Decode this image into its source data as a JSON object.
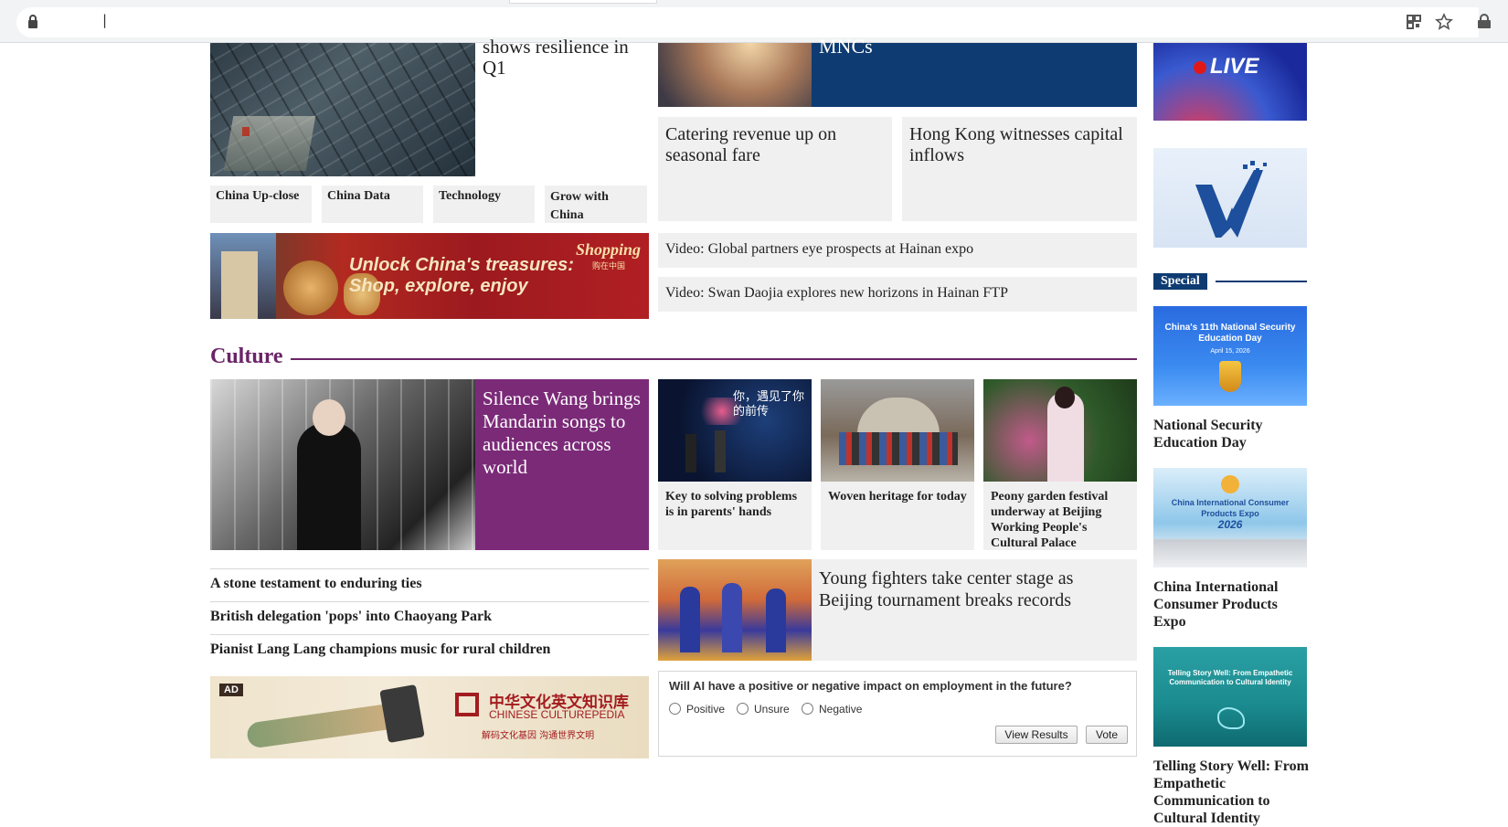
{
  "top": {
    "feature_left_title": "shows resilience in Q1",
    "feature_right_title": "MNCs",
    "tiles": [
      {
        "title": "Catering revenue up on seasonal fare"
      },
      {
        "title": "Hong Kong witnesses capital inflows"
      }
    ],
    "category_links": [
      "China Up-close",
      "China Data",
      "Technology",
      "Grow with China"
    ],
    "banner_text": "Unlock China's treasures: Shop, explore, enjoy",
    "banner_brand": "Shopping",
    "banner_brand_cn": "购在中国",
    "video_links": [
      "Video: Global partners eye prospects at Hainan expo",
      "Video: Swan Daojia explores new horizons in Hainan FTP"
    ]
  },
  "culture": {
    "section_label": "Culture",
    "feature_title": "Silence Wang brings Mandarin songs to audiences across world",
    "thumbs": [
      {
        "title": "Key to solving problems is in parents' hands",
        "img_text": "你，遇见了你的前传"
      },
      {
        "title": "Woven heritage for today"
      },
      {
        "title": "Peony garden festival underway at Beijing Working People's Cultural Palace"
      }
    ],
    "list": [
      "A stone testament to enduring ties",
      "British delegation 'pops' into Chaoyang Park",
      "Pianist Lang Lang champions music for rural children"
    ],
    "wide_title": "Young fighters take center stage as Beijing tournament breaks records",
    "ad": {
      "badge": "AD",
      "cn_title": "中华文化英文知识库",
      "en_title": "CHINESE CULTUREPEDIA",
      "cn_sub": "解码文化基因  沟通世界文明"
    }
  },
  "poll": {
    "question": "Will AI have a positive or negative impact on employment in the future?",
    "options": [
      "Positive",
      "Unsure",
      "Negative"
    ],
    "view_results": "View Results",
    "vote": "Vote"
  },
  "sidebar": {
    "live_label": "LIVE",
    "special_label": "Special",
    "items": [
      {
        "title": "National Security Education Day",
        "img_text": "China's 11th National Security Education Day",
        "img_date": "April 15, 2026"
      },
      {
        "title": "China International Consumer Products Expo",
        "img_text": "China International Consumer Products Expo",
        "img_year": "2026"
      },
      {
        "title": "Telling Story Well: From Empathetic Communication to Cultural Identity",
        "img_text": "Telling Story Well: From Empathetic Communication to Cultural Identity"
      }
    ]
  },
  "colors": {
    "culture_purple": "#6b2468",
    "navy": "#0e3b72",
    "ad_red": "#9c1a1f"
  },
  "icons": [
    "lock-icon",
    "qr-icon",
    "star-icon",
    "profile-icon"
  ]
}
